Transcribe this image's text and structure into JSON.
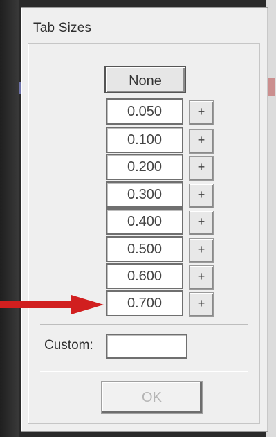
{
  "dialog": {
    "title": "Tab Sizes",
    "none_label": "None",
    "tab_sizes": [
      {
        "value": "0.050",
        "add_label": "+"
      },
      {
        "value": "0.100",
        "add_label": "+"
      },
      {
        "value": "0.200",
        "add_label": "+"
      },
      {
        "value": "0.300",
        "add_label": "+"
      },
      {
        "value": "0.400",
        "add_label": "+"
      },
      {
        "value": "0.500",
        "add_label": "+"
      },
      {
        "value": "0.600",
        "add_label": "+"
      },
      {
        "value": "0.700",
        "add_label": "+"
      }
    ],
    "custom_label": "Custom:",
    "custom_value": "",
    "ok_label": "OK"
  },
  "colors": {
    "arrow": "#d11f1f",
    "ok_disabled_text": "#b5b5b5"
  }
}
